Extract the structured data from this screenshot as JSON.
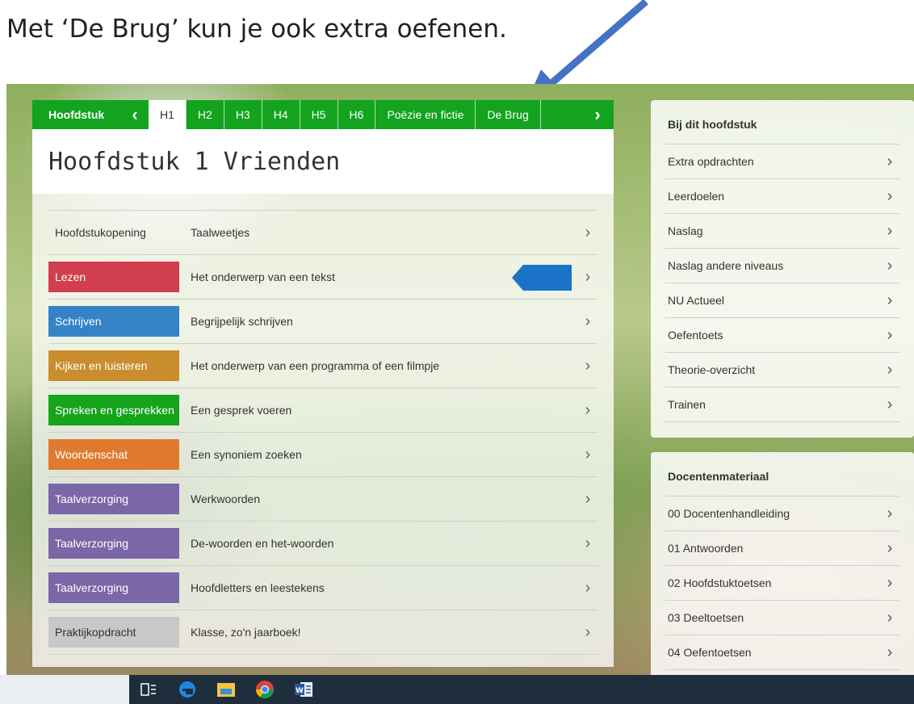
{
  "caption": "Met ‘De Brug’ kun je ook extra oefenen.",
  "chapter_nav": {
    "label": "Hoofdstuk",
    "tabs": [
      "H1",
      "H2",
      "H3",
      "H4",
      "H5",
      "H6",
      "Poëzie en fictie",
      "De Brug"
    ],
    "active": "H1"
  },
  "chapter_title": "Hoofdstuk 1 Vrienden",
  "rows": [
    {
      "category": "Hoofdstukopening",
      "topic": "Taalweetjes",
      "color": ""
    },
    {
      "category": "Lezen",
      "topic": "Het onderwerp van een tekst",
      "color": "#d13f4f"
    },
    {
      "category": "Schrijven",
      "topic": "Begrijpelijk schrijven",
      "color": "#3483c6"
    },
    {
      "category": "Kijken en luisteren",
      "topic": "Het onderwerp van een programma of een filmpje",
      "color": "#c98d2e"
    },
    {
      "category": "Spreken en gesprekken",
      "topic": "Een gesprek voeren",
      "color": "#15a41b"
    },
    {
      "category": "Woordenschat",
      "topic": "Een synoniem zoeken",
      "color": "#e07a2f"
    },
    {
      "category": "Taalverzorging",
      "topic": "Werkwoorden",
      "color": "#7b66a8"
    },
    {
      "category": "Taalverzorging",
      "topic": "De-woorden en het-woorden",
      "color": "#7b66a8"
    },
    {
      "category": "Taalverzorging",
      "topic": "Hoofdletters en leestekens",
      "color": "#7b66a8"
    },
    {
      "category": "Praktijkopdracht",
      "topic": "Klasse, zo'n jaarboek!",
      "color": "#c8c8c8"
    }
  ],
  "side_panel": {
    "title": "Bij dit hoofdstuk",
    "items": [
      "Extra opdrachten",
      "Leerdoelen",
      "Naslag",
      "Naslag andere niveaus",
      "NU Actueel",
      "Oefentoets",
      "Theorie-overzicht",
      "Trainen"
    ]
  },
  "teacher_panel": {
    "title": "Docentenmateriaal",
    "items": [
      "00 Docentenhandleiding",
      "01 Antwoorden",
      "02 Hoofdstuktoetsen",
      "03 Deeltoetsen",
      "04 Oefentoetsen"
    ]
  },
  "colors": {
    "nav_green": "#14a31e",
    "arrow_blue": "#4472c4",
    "pointer_blue": "#1a73c9",
    "taskbar": "#1f2e3c"
  },
  "taskbar_icons": [
    "task-view-icon",
    "edge-icon",
    "file-explorer-icon",
    "chrome-icon",
    "word-icon"
  ]
}
